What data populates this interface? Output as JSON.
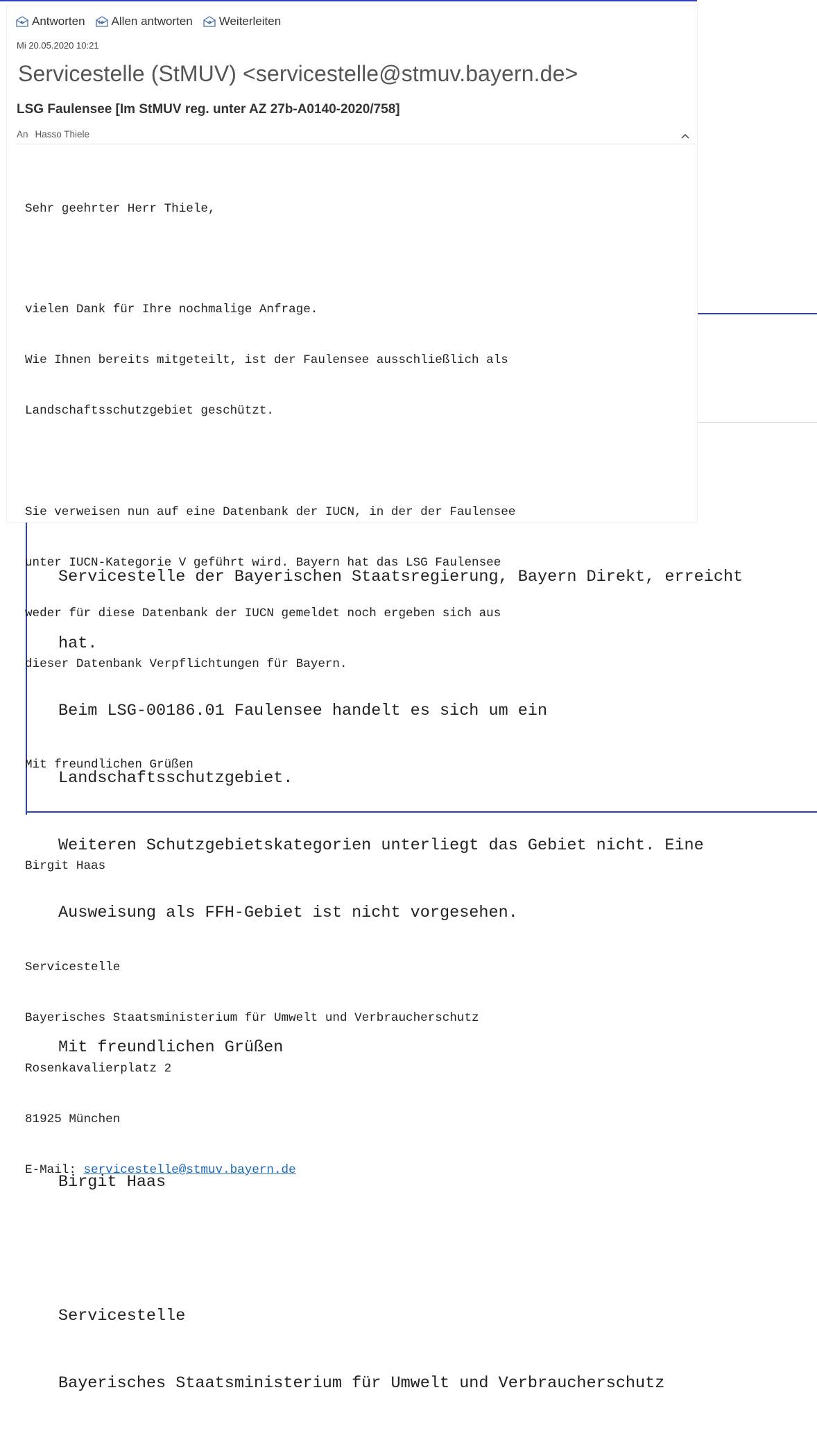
{
  "background_email": {
    "top_strip_text": "",
    "body_lines": [
      "Servicestelle der Bayerischen Staatsregierung, Bayern Direkt, erreicht",
      "hat.",
      "Beim LSG-00186.01 Faulensee handelt es sich um ein",
      "Landschaftsschutzgebiet.",
      "Weiteren Schutzgebietskategorien unterliegt das Gebiet nicht. Eine",
      "Ausweisung als FFH-Gebiet ist nicht vorgesehen.",
      "",
      "Mit freundlichen Grüßen",
      "",
      "Birgit Haas",
      "",
      "Servicestelle",
      "Bayerisches Staatsministerium für Umwelt und Verbraucherschutz"
    ],
    "accent_color": "#2b3fbf"
  },
  "foreground_email": {
    "actions": [
      {
        "label": "Antworten",
        "icon": "reply-icon"
      },
      {
        "label": "Allen antworten",
        "icon": "reply-all-icon"
      },
      {
        "label": "Weiterleiten",
        "icon": "forward-icon"
      }
    ],
    "date": "Mi 20.05.2020 10:21",
    "sender": "Servicestelle (StMUV) <servicestelle@stmuv.bayern.de>",
    "subject": "LSG Faulensee [Im StMUV reg. unter AZ 27b-A0140-2020/758]",
    "to_label": "An",
    "to_name": "Hasso Thiele",
    "body": {
      "greeting": "Sehr geehrter Herr Thiele,",
      "para1": [
        "vielen Dank für Ihre nochmalige Anfrage.",
        "Wie Ihnen bereits mitgeteilt, ist der Faulensee ausschließlich als",
        "Landschaftsschutzgebiet geschützt."
      ],
      "para2": [
        "Sie verweisen nun auf eine Datenbank der IUCN, in der der Faulensee",
        "unter IUCN-Kategorie V geführt wird. Bayern hat das LSG Faulensee",
        "weder für diese Datenbank der IUCN gemeldet noch ergeben sich aus",
        "dieser Datenbank Verpflichtungen für Bayern."
      ],
      "closing": "Mit freundlichen Grüßen",
      "signature_name": "Birgit Haas",
      "signature": [
        "Servicestelle",
        "Bayerisches Staatsministerium für Umwelt und Verbraucherschutz",
        "Rosenkavalierplatz 2",
        "81925 München"
      ],
      "email_label": "E-Mail: ",
      "email_link": "servicestelle@stmuv.bayern.de"
    },
    "link_color": "#1a66b8"
  }
}
